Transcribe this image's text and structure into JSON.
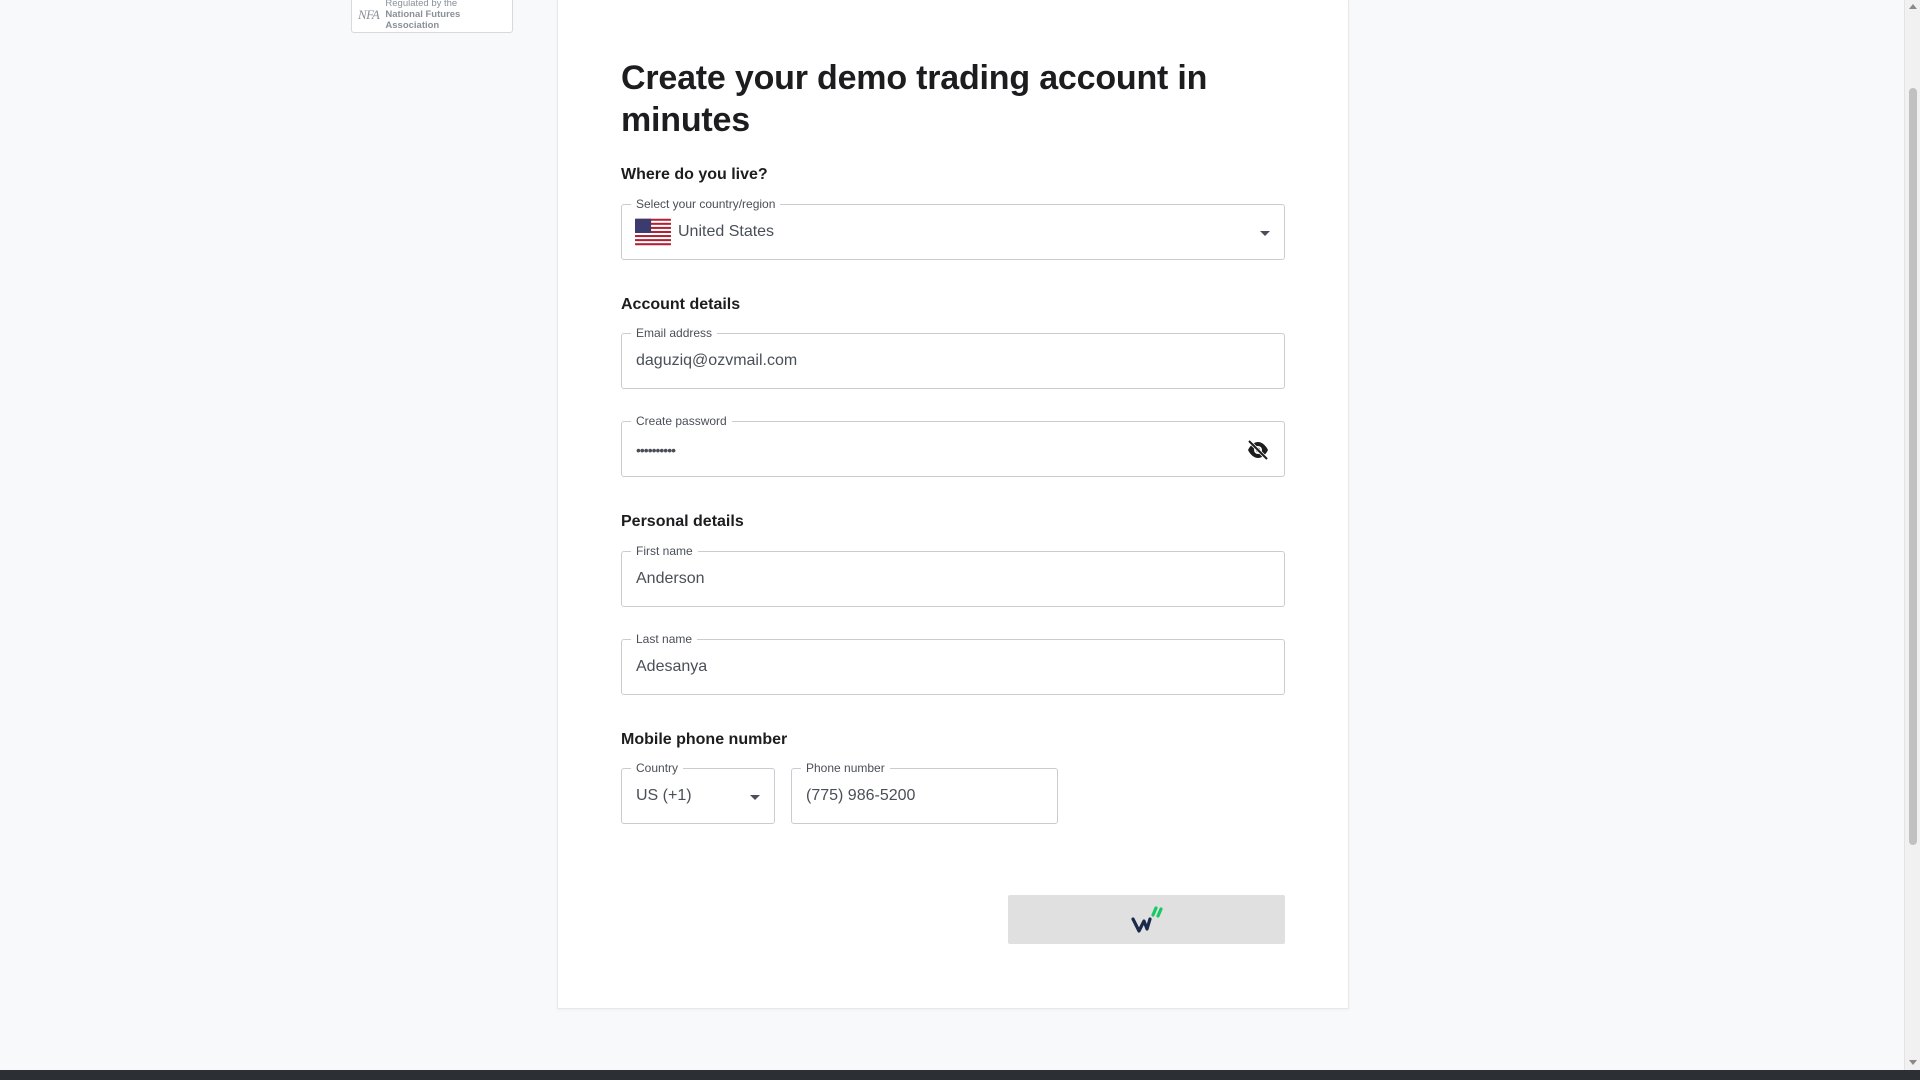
{
  "badge": {
    "logo": "NFA",
    "line1": "Regulated by the",
    "line2": "National Futures",
    "line3": "Association"
  },
  "form": {
    "title": "Create your demo trading account in minutes",
    "residence": {
      "heading": "Where do you live?",
      "country_legend": "Select your country/region",
      "country_value": "United States",
      "flag_icon": "us-flag-icon"
    },
    "account": {
      "heading": "Account details",
      "email_legend": "Email address",
      "email_value": "daguziq@ozvmail.com",
      "password_legend": "Create password",
      "password_value": "••••••••••",
      "visibility_icon": "eye-off-icon"
    },
    "personal": {
      "heading": "Personal details",
      "first_name_legend": "First name",
      "first_name_value": "Anderson",
      "last_name_legend": "Last name",
      "last_name_value": "Adesanya"
    },
    "phone": {
      "heading": "Mobile phone number",
      "country_legend": "Country",
      "country_value": "US (+1)",
      "number_legend": "Phone number",
      "number_value": "(775) 986-5200"
    },
    "submit": {
      "icon": "loading-spinner-icon"
    }
  },
  "colors": {
    "brand_dark": "#1b2a4a",
    "brand_green": "#17c964",
    "submit_bg": "#e0e0e0"
  }
}
